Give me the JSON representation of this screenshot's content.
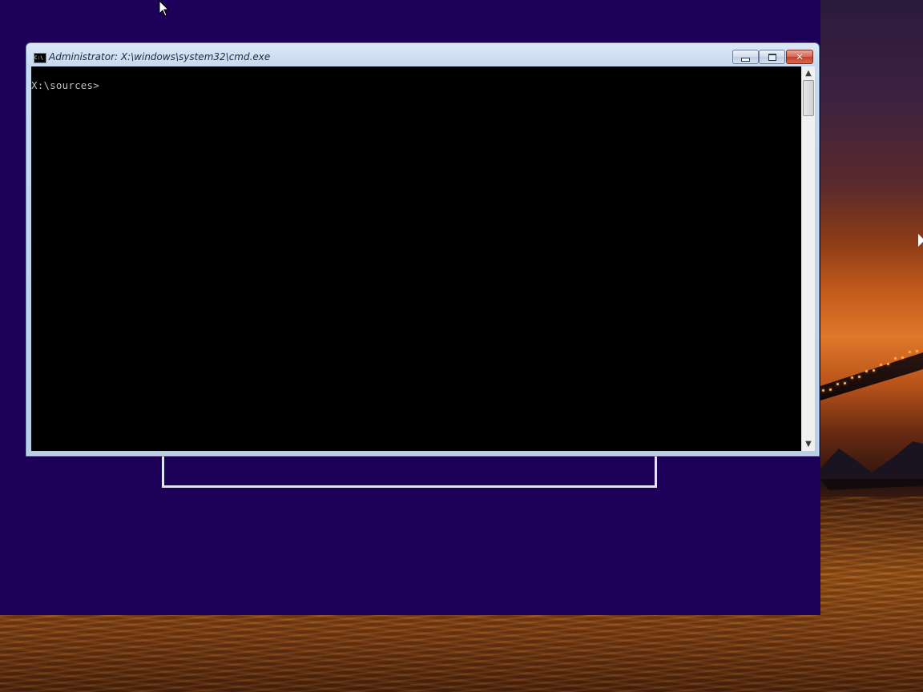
{
  "window": {
    "title": "Administrator: X:\\windows\\system32\\cmd.exe",
    "icon": "cmd-icon",
    "icon_text": "C:\\"
  },
  "controls": {
    "minimize": "window-minimize-icon",
    "maximize": "window-maximize-icon",
    "close": "✕"
  },
  "console": {
    "prompt": "X:\\sources>"
  },
  "scrollbar": {
    "up": "▲",
    "down": "▼"
  },
  "colors": {
    "setup_background": "#1d0058",
    "console_background": "#000000",
    "console_text": "#c0c0c0",
    "close_button": "#c2402a"
  }
}
